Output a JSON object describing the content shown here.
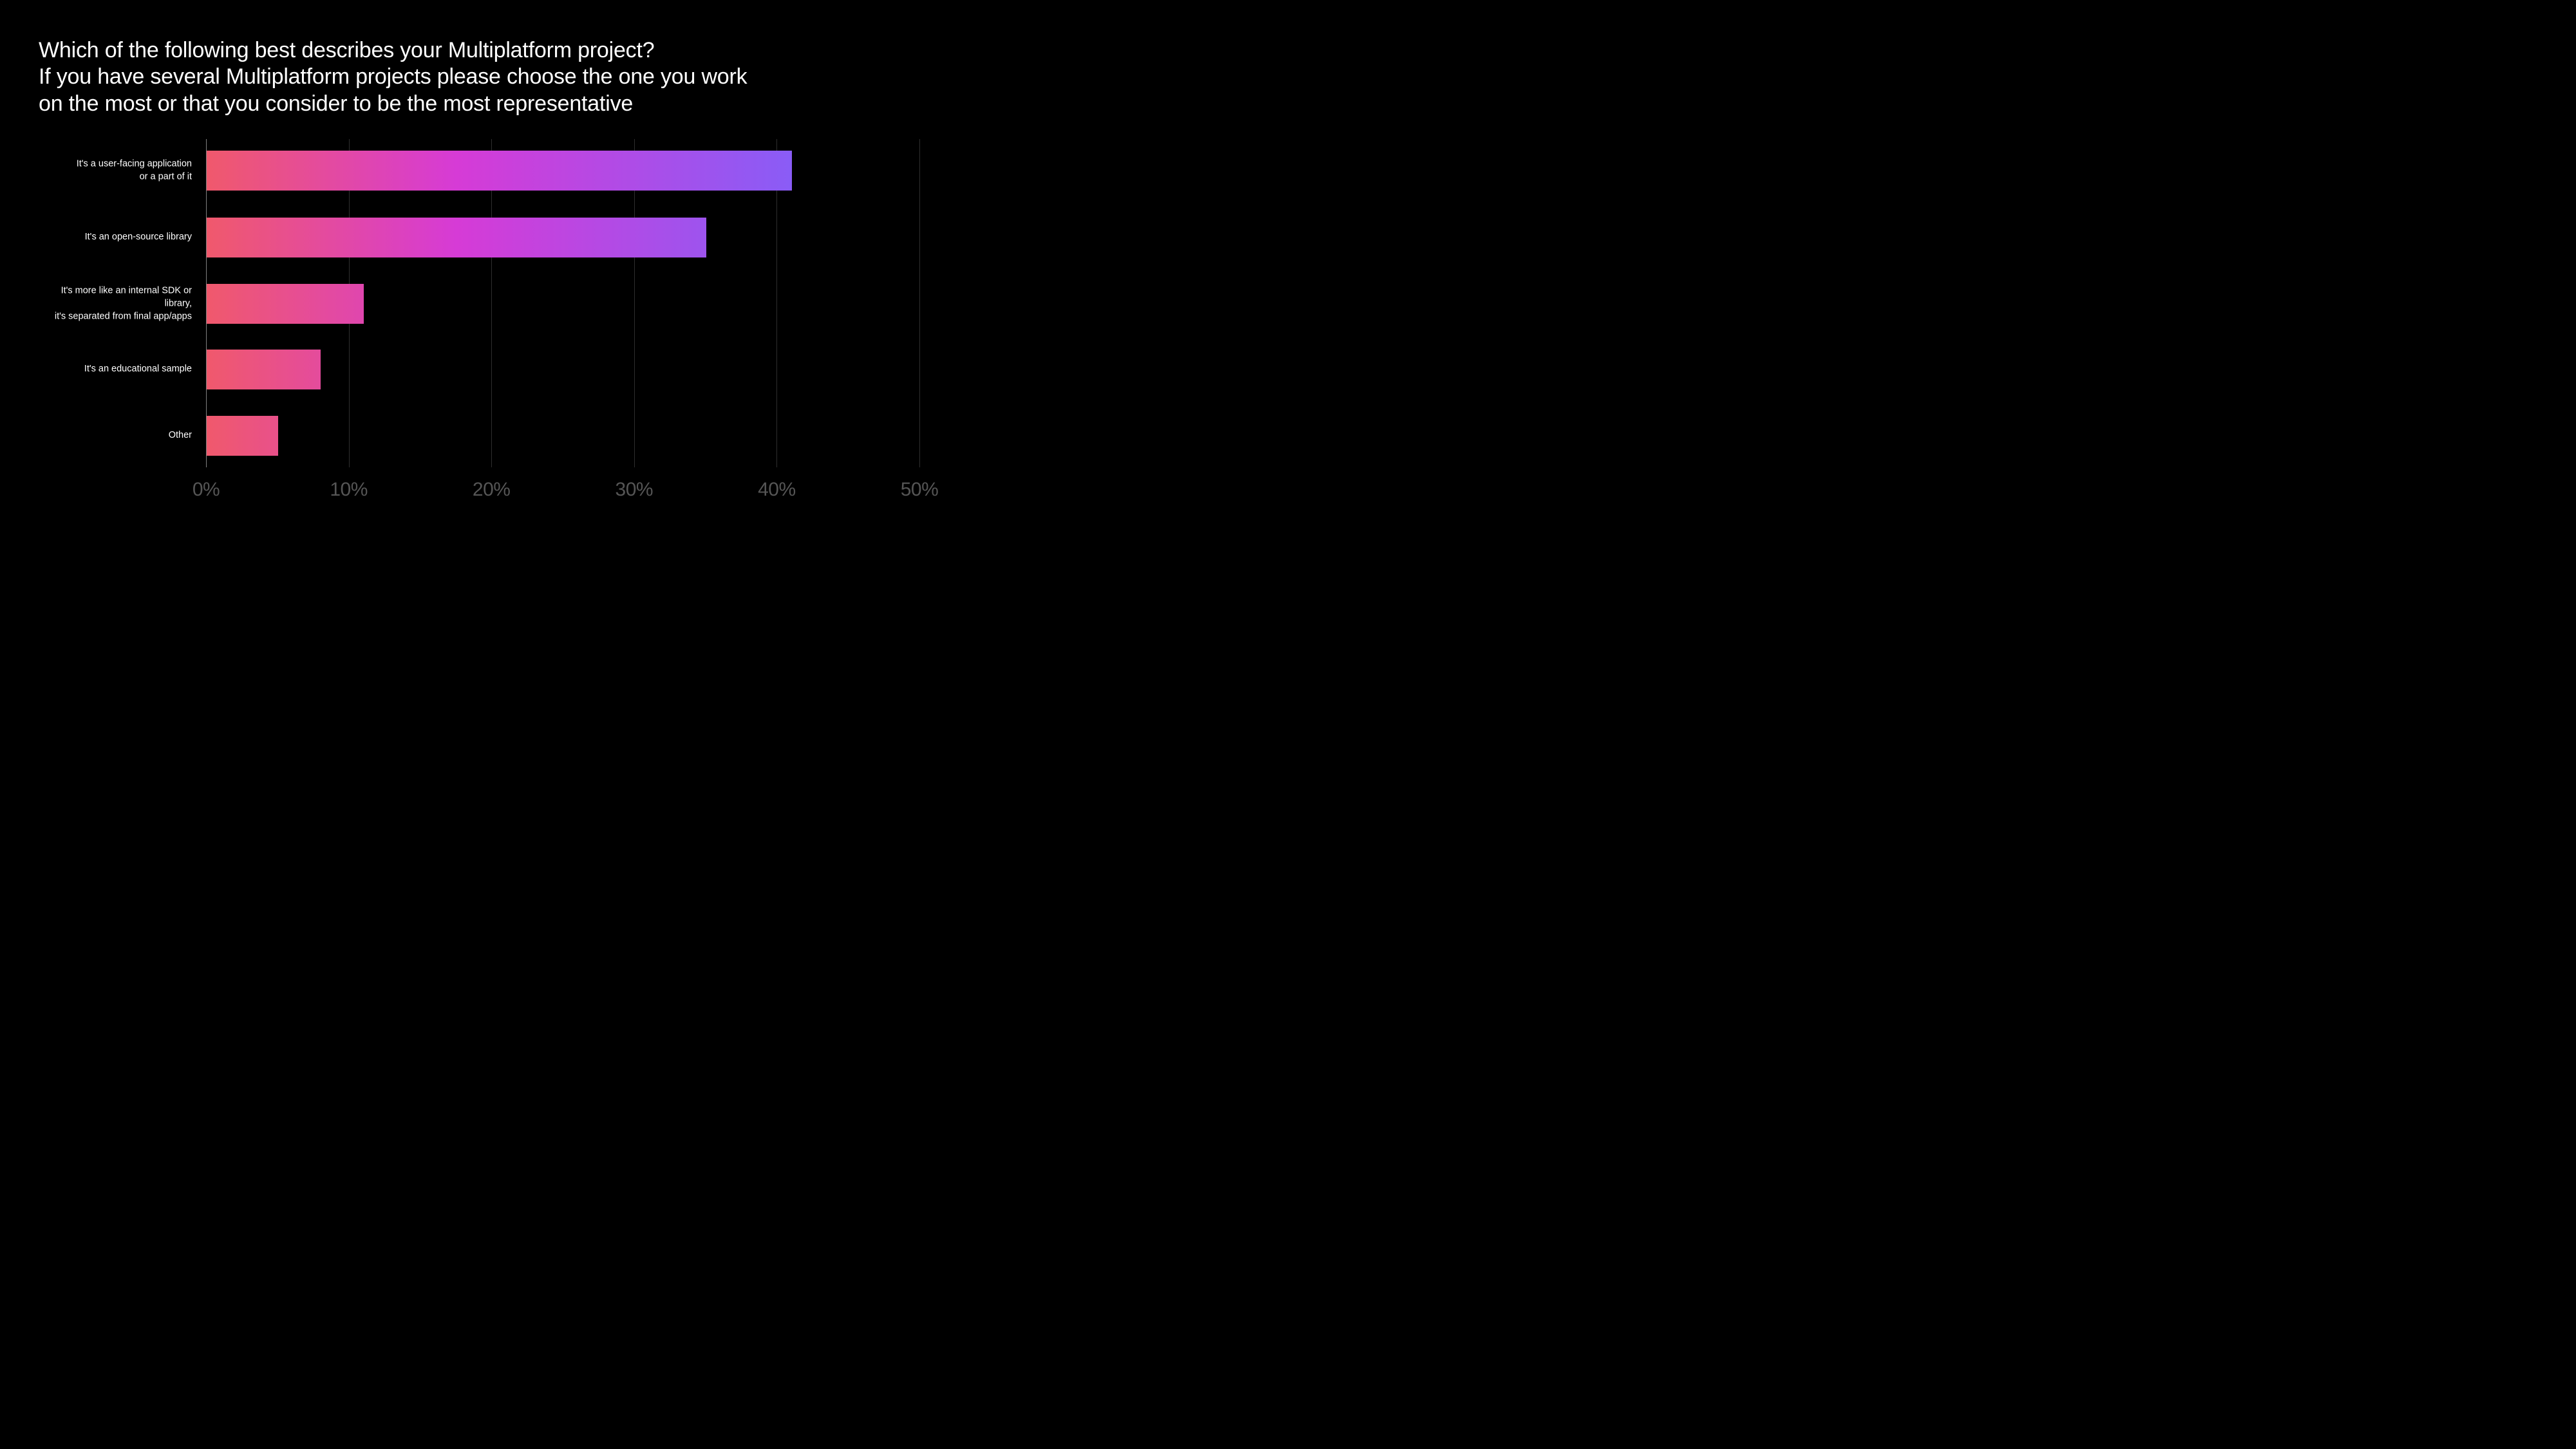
{
  "title": {
    "line1": "Which of the following best describes your Multiplatform project?",
    "line2": "If you have several Multiplatform projects please choose the one you work",
    "line3": "on the most or that you consider to be the most representative"
  },
  "chart_data": {
    "type": "bar",
    "orientation": "horizontal",
    "categories": [
      "It's a user-facing application or a part of it",
      "It's an open-source library",
      "It's more like an internal SDK or library, it's separated from final app/apps",
      "It's an educational sample",
      "Other"
    ],
    "values": [
      41,
      35,
      11,
      8,
      5
    ],
    "title": "Which of the following best describes your Multiplatform project? If you have several Multiplatform projects please choose the one you work on the most or that you consider to be the most representative",
    "xlabel": "",
    "ylabel": "",
    "xlim": [
      0,
      50
    ],
    "ticks": [
      0,
      10,
      20,
      30,
      40,
      50
    ],
    "tick_labels": [
      "0%",
      "10%",
      "20%",
      "30%",
      "40%",
      "50%"
    ],
    "bar_gradient": {
      "from": "#F0596C",
      "via": "#D63BD6",
      "to": "#8A5CF6"
    }
  },
  "category_lines": [
    [
      "It's a user-facing application",
      "or a part of it"
    ],
    [
      "It's an open-source library"
    ],
    [
      "It's more like an internal SDK or library,",
      "it's separated from final app/apps"
    ],
    [
      "It's an educational sample"
    ],
    [
      "Other"
    ]
  ]
}
